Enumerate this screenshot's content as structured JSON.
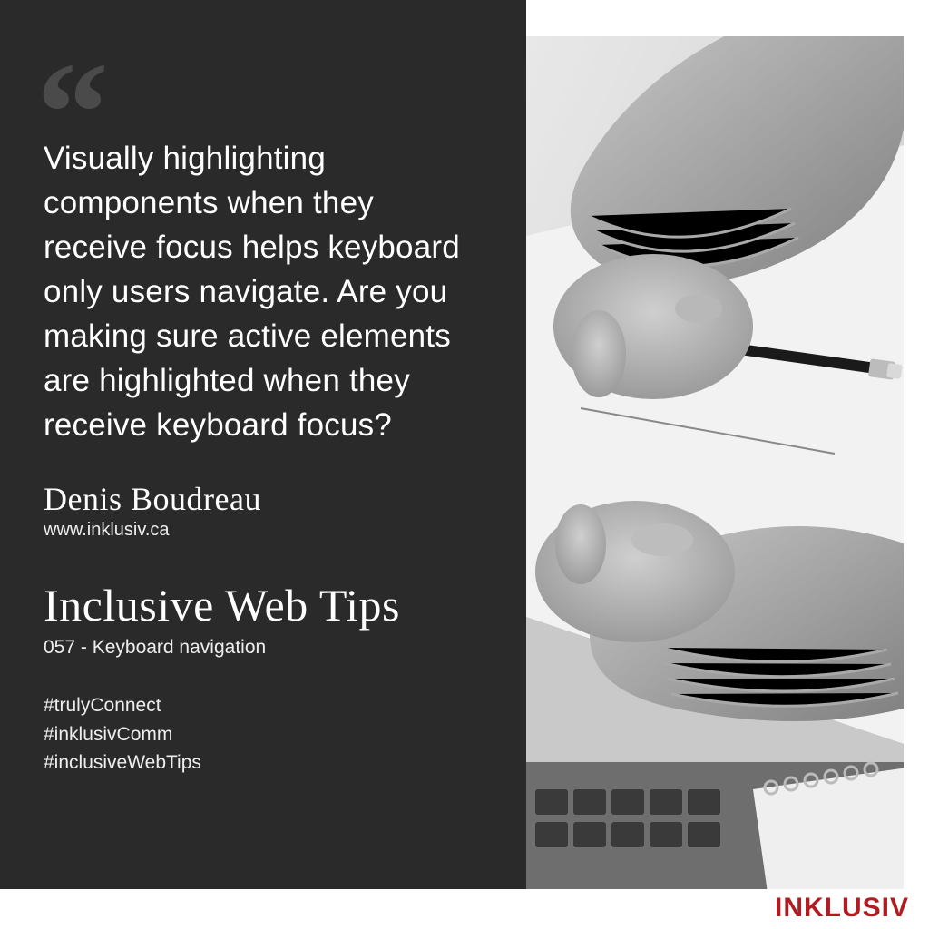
{
  "quote": "Visually highlighting components when they receive focus helps keyboard only users navigate. Are you making sure active elements are highlighted when they receive keyboard focus?",
  "author": "Denis Boudreau",
  "website": "www.inklusiv.ca",
  "seriesTitle": "Inclusive Web Tips",
  "episode": "057 - Keyboard navigation",
  "hashtags": [
    "#trulyConnect",
    "#inklusivComm",
    "#inclusiveWebTips"
  ],
  "brand": "INKLUSIV",
  "colors": {
    "panel": "#2a2a2a",
    "brand": "#b01c22"
  }
}
